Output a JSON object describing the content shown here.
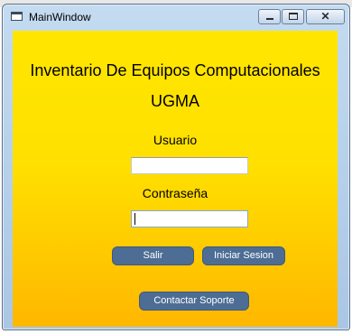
{
  "window": {
    "title": "MainWindow"
  },
  "form": {
    "heading": "Inventario De Equipos Computacionales",
    "subheading": "UGMA",
    "username_label": "Usuario",
    "username_value": "",
    "password_label": "Contraseña",
    "password_value": "",
    "exit_button": "Salir",
    "login_button": "Iniciar Sesion",
    "support_button": "Contactar Soporte"
  },
  "colors": {
    "background_top": "#ffe600",
    "background_bottom": "#ffb700",
    "button": "#4d6d94"
  }
}
